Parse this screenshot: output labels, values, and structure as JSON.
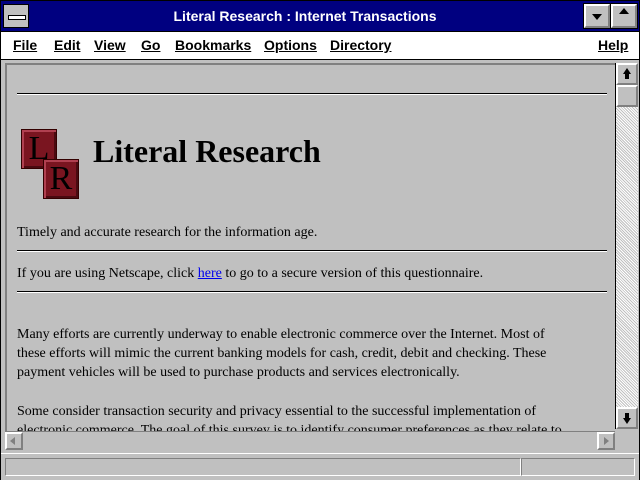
{
  "window": {
    "title": "Literal Research : Internet Transactions"
  },
  "menubar": {
    "items": [
      {
        "label": "File"
      },
      {
        "label": "Edit"
      },
      {
        "label": "View"
      },
      {
        "label": "Go"
      },
      {
        "label": "Bookmarks"
      },
      {
        "label": "Options"
      },
      {
        "label": "Directory"
      },
      {
        "label": "Help"
      }
    ]
  },
  "page": {
    "logo_letters": [
      "L",
      "R"
    ],
    "heading": "Literal Research",
    "tagline": "Timely and accurate research for the information age.",
    "netscape_line": {
      "before": "If you are using Netscape, click ",
      "link": "here",
      "after": " to go to a secure version of this questionnaire."
    },
    "paragraph1": [
      "Many efforts are currently underway to enable electronic commerce over the Internet. Most of",
      "these efforts will mimic the current banking models for cash, credit, debit and checking. These",
      "payment vehicles will be used to purchase products and services electronically."
    ],
    "paragraph2": [
      "Some consider transaction security and privacy essential to the successful implementation of",
      "electronic commerce. The goal of this survey is to identify consumer preferences as they relate to"
    ]
  },
  "statusbar": {
    "text": ""
  },
  "colors": {
    "titlebar": "#000080",
    "chrome": "#c0c0c0",
    "link": "#0000ee",
    "logo": "#7a1520"
  }
}
